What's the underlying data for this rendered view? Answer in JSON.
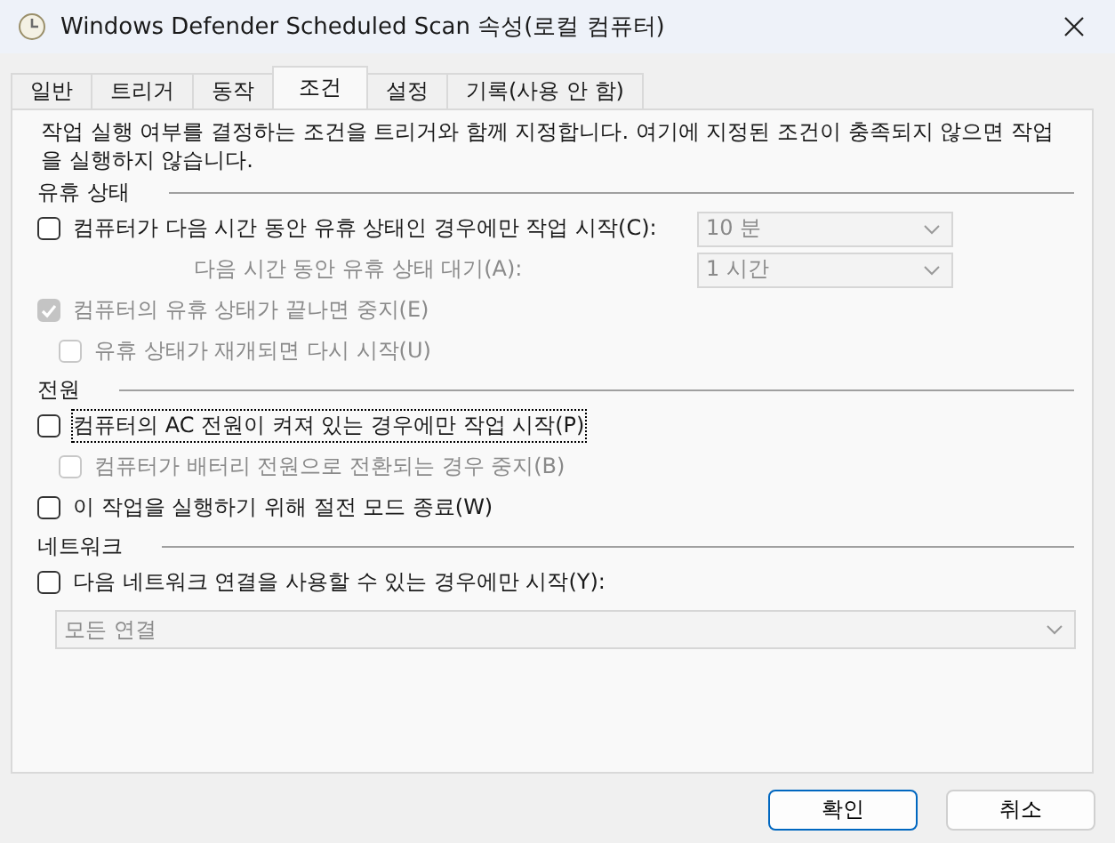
{
  "window": {
    "title": "Windows Defender Scheduled Scan 속성(로컬 컴퓨터)"
  },
  "tabs": [
    {
      "label": "일반",
      "selected": false
    },
    {
      "label": "트리거",
      "selected": false
    },
    {
      "label": "동작",
      "selected": false
    },
    {
      "label": "조건",
      "selected": true
    },
    {
      "label": "설정",
      "selected": false
    },
    {
      "label": "기록(사용 안 함)",
      "selected": false
    }
  ],
  "description": "작업 실행 여부를 결정하는 조건을 트리거와 함께 지정합니다. 여기에 지정된 조건이 충족되지 않으면 작업을 실행하지 않습니다.",
  "groups": [
    {
      "title": "유휴 상태",
      "items": [
        {
          "kind": "checkbox",
          "label": "컴퓨터가 다음 시간 동안 유휴 상태인 경우에만 작업 시작(C):",
          "checked": false,
          "disabled": false,
          "focused": false,
          "dropdown": {
            "value": "10 분",
            "disabled": true
          }
        },
        {
          "kind": "label",
          "label": "다음 시간 동안 유휴 상태 대기(A):",
          "disabled": true,
          "dropdown": {
            "value": "1 시간",
            "disabled": true
          }
        },
        {
          "kind": "checkbox",
          "label": "컴퓨터의 유휴 상태가 끝나면 중지(E)",
          "checked": true,
          "disabled": true,
          "focused": false,
          "children": [
            {
              "kind": "checkbox",
              "label": "유휴 상태가 재개되면 다시 시작(U)",
              "checked": false,
              "disabled": true,
              "focused": false
            }
          ]
        }
      ]
    },
    {
      "title": "전원",
      "items": [
        {
          "kind": "checkbox",
          "label": "컴퓨터의 AC 전원이 켜져 있는 경우에만 작업 시작(P)",
          "checked": false,
          "disabled": false,
          "focused": true,
          "children": [
            {
              "kind": "checkbox",
              "label": "컴퓨터가 배터리 전원으로 전환되는 경우 중지(B)",
              "checked": false,
              "disabled": true,
              "focused": false
            }
          ]
        },
        {
          "kind": "checkbox",
          "label": "이 작업을 실행하기 위해 절전 모드 종료(W)",
          "checked": false,
          "disabled": false,
          "focused": false
        }
      ]
    },
    {
      "title": "네트워크",
      "items": [
        {
          "kind": "checkbox",
          "label": "다음 네트워크 연결을 사용할 수 있는 경우에만 시작(Y):",
          "checked": false,
          "disabled": false,
          "focused": false
        },
        {
          "kind": "wide-dropdown",
          "dropdown": {
            "value": "모든 연결",
            "disabled": true
          }
        }
      ]
    }
  ],
  "buttons": [
    {
      "label": "확인",
      "default": true
    },
    {
      "label": "취소",
      "default": false
    }
  ]
}
